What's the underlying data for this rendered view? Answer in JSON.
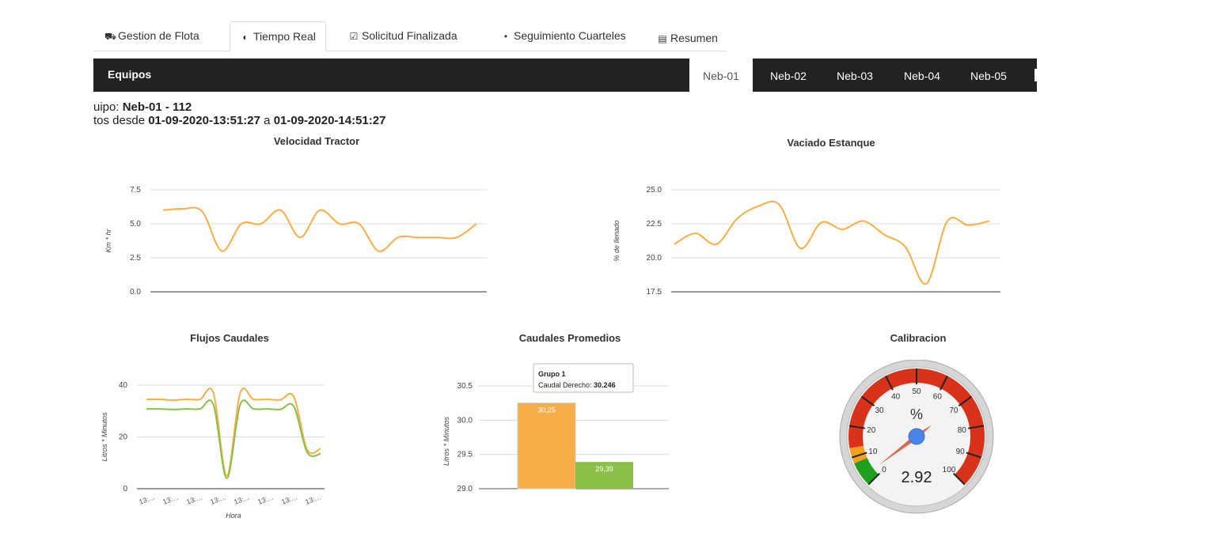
{
  "tabs": [
    {
      "icon": "truck-icon",
      "glyph": "⛟",
      "label": "Gestion de Flota"
    },
    {
      "icon": "toggle-icon",
      "glyph": "◐",
      "label": "Tiempo Real"
    },
    {
      "icon": "check-square-icon",
      "glyph": "☑",
      "label": "Solicitud Finalizada"
    },
    {
      "icon": "map-marker-icon",
      "glyph": "•",
      "label": "Seguimiento Cuarteles"
    },
    {
      "icon": "file-icon",
      "glyph": "▤",
      "label": "Resumen"
    }
  ],
  "navbar": {
    "brand": "Equipos",
    "items": [
      "Neb-01",
      "Neb-02",
      "Neb-03",
      "Neb-04",
      "Neb-05"
    ],
    "active": "Neb-01"
  },
  "info": {
    "line1_prefix": "uipo: ",
    "line1_value": "Neb-01 - 112",
    "line2_prefix": "tos desde ",
    "line2_from": "01-09-2020-13:51:27",
    "line2_mid": " a ",
    "line2_to": "01-09-2020-14:51:27"
  },
  "colors": {
    "orange": "#f7ae47",
    "green": "#8bbf4a",
    "navbar": "#222222"
  },
  "chart_data": [
    {
      "type": "line",
      "title": "Velocidad Tractor",
      "ylabel": "Km * hr",
      "xlabel": "",
      "ylim": [
        0,
        7.5
      ],
      "yticks": [
        "0.0",
        "2.5",
        "5.0",
        "7.5"
      ],
      "series": [
        {
          "color": "#f7ae47",
          "values": [
            6.0,
            6.1,
            5.9,
            3.0,
            5.0,
            5.0,
            6.0,
            4.0,
            6.0,
            5.0,
            5.0,
            3.0,
            4.0,
            4.0,
            4.0,
            4.0,
            5.0
          ]
        }
      ]
    },
    {
      "type": "line",
      "title": "Vaciado Estanque",
      "ylabel": "% de llenado",
      "xlabel": "",
      "ylim": [
        17.5,
        25.0
      ],
      "yticks": [
        "17.5",
        "20.0",
        "22.5",
        "25.0"
      ],
      "series": [
        {
          "color": "#f7ae47",
          "values": [
            21.0,
            21.8,
            21.0,
            22.9,
            23.8,
            23.9,
            20.7,
            22.6,
            22.1,
            22.7,
            21.7,
            20.8,
            18.1,
            22.7,
            22.4,
            22.7
          ]
        }
      ]
    },
    {
      "type": "line",
      "title": "Flujos Caudales",
      "ylabel": "Litros * Minutos",
      "xlabel": "Hora",
      "ylim": [
        0,
        40
      ],
      "yticks": [
        "0",
        "20",
        "40"
      ],
      "categories": [
        "13:...",
        "13:...",
        "13:...",
        "13:...",
        "13:...",
        "13:...",
        "13:...",
        "13:..."
      ],
      "series": [
        {
          "color": "#f7ae47",
          "values": [
            34.5,
            34.5,
            34.2,
            34.5,
            34.5,
            37.0,
            5.0,
            37.0,
            34.5,
            34.5,
            34.3,
            35.5,
            15.0,
            15.5
          ]
        },
        {
          "color": "#8bbf4a",
          "values": [
            30.8,
            30.8,
            30.6,
            30.8,
            30.8,
            32.5,
            4.0,
            32.5,
            30.8,
            30.8,
            30.6,
            31.8,
            14.0,
            13.5
          ]
        }
      ]
    },
    {
      "type": "bar",
      "title": "Caudales Promedios",
      "ylabel": "Litros * Minutos",
      "xlabel": "",
      "ylim": [
        29.0,
        30.5
      ],
      "yticks": [
        "29.0",
        "29.5",
        "30.0",
        "30.5"
      ],
      "series": [
        {
          "color": "#f7ae47",
          "value": 30.25,
          "label": "30,25"
        },
        {
          "color": "#8bbf4a",
          "value": 29.39,
          "label": "29,39"
        }
      ],
      "tooltip": {
        "title": "Grupo 1",
        "label": "Caudal Derecho: ",
        "value": "30.246"
      }
    },
    {
      "type": "gauge",
      "title": "Calibracion",
      "value": 2.92,
      "value_label": "2.92",
      "unit": "%",
      "min": 0,
      "max": 100,
      "tick_labels": [
        "0",
        "10",
        "20",
        "30",
        "40",
        "50",
        "60",
        "70",
        "80",
        "90",
        "100"
      ]
    }
  ]
}
